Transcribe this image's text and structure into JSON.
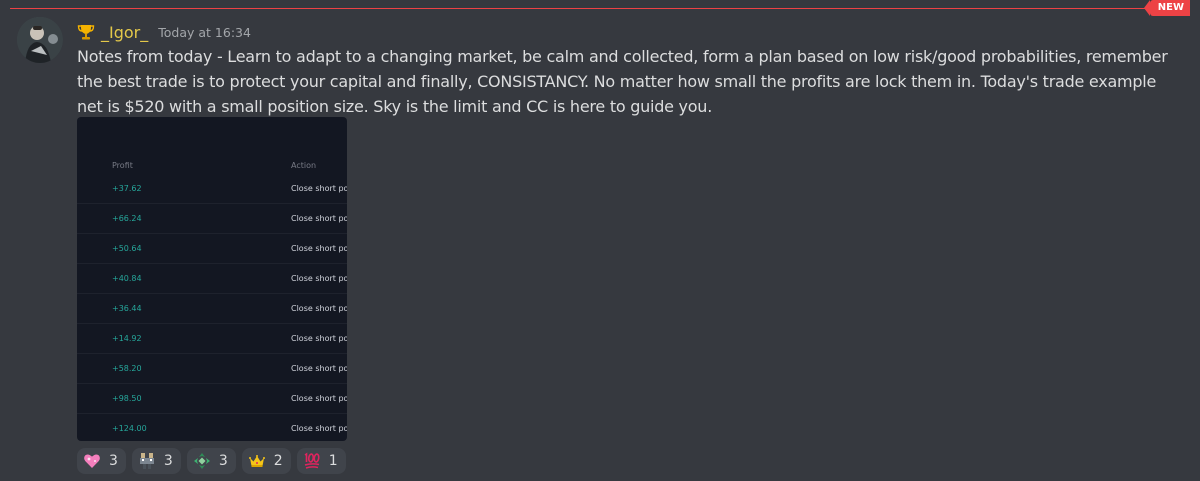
{
  "divider": {
    "badge": "NEW",
    "color": "#ed4245"
  },
  "message": {
    "username": "_Igor_",
    "username_color": "#e4c84a",
    "timestamp": "Today at 16:34",
    "text": "Notes from today - Learn to adapt to a changing market, be calm and collected, form a plan based on low risk/good probabilities, remember the best trade is to protect your capital and finally, CONSISTANCY. No matter how small the profits are lock them in. Today's trade example net is $520 with a small position size. Sky is the limit and CC is here to guide you.",
    "badge_icon": "trophy-icon",
    "avatar_icon": "user-avatar"
  },
  "attachment": {
    "columns": {
      "profit": "Profit",
      "action": "Action"
    },
    "rows": [
      {
        "profit": "+37.62",
        "action": "Close short po"
      },
      {
        "profit": "+66.24",
        "action": "Close short po"
      },
      {
        "profit": "+50.64",
        "action": "Close short po"
      },
      {
        "profit": "+40.84",
        "action": "Close short po"
      },
      {
        "profit": "+36.44",
        "action": "Close short po"
      },
      {
        "profit": "+14.92",
        "action": "Close short po"
      },
      {
        "profit": "+58.20",
        "action": "Close short po"
      },
      {
        "profit": "+98.50",
        "action": "Close short po"
      },
      {
        "profit": "+124.00",
        "action": "Close short po"
      }
    ]
  },
  "reactions": [
    {
      "icon": "sparkling-heart-icon",
      "count": "3"
    },
    {
      "icon": "custom-emoji-icon",
      "count": "3"
    },
    {
      "icon": "custom-emoji-2-icon",
      "count": "3"
    },
    {
      "icon": "crown-icon",
      "count": "2"
    },
    {
      "icon": "hundred-points-icon",
      "count": "1"
    }
  ]
}
